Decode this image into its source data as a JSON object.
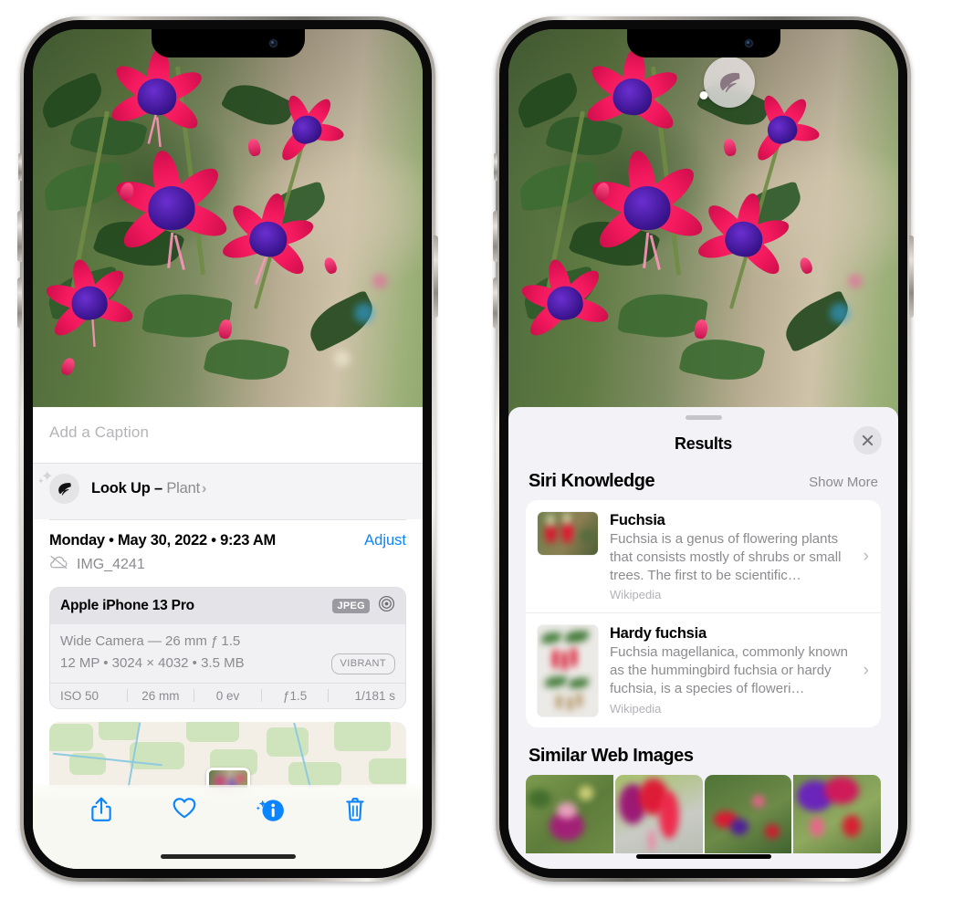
{
  "left_phone": {
    "caption": {
      "placeholder": "Add a Caption",
      "value": ""
    },
    "look_up": {
      "label": "Look Up",
      "dash": "–",
      "subject": "Plant",
      "chevron": "›",
      "icon": "leaf-icon"
    },
    "date_line": "Monday • May 30, 2022 • 9:23 AM",
    "adjust_label": "Adjust",
    "file_name": "IMG_4241",
    "cloud_icon": "cloud-slash-icon",
    "exif": {
      "model": "Apple iPhone 13 Pro",
      "format_badge": "JPEG",
      "aperture_icon": "aperture-icon",
      "lens_line": "Wide Camera — 26 mm ƒ 1.5",
      "spec_line": "12 MP • 3024 × 4032 • 3.5 MB",
      "style_badge": "VIBRANT",
      "stats": [
        "ISO 50",
        "26 mm",
        "0 ev",
        "ƒ1.5",
        "1/181 s"
      ]
    },
    "toolbar": [
      {
        "name": "share-button",
        "icon": "share-icon"
      },
      {
        "name": "favorite-button",
        "icon": "heart-icon"
      },
      {
        "name": "info-button",
        "icon": "info-sparkle-icon"
      },
      {
        "name": "delete-button",
        "icon": "trash-icon"
      }
    ],
    "map": {
      "pin_icon": "photo-pin"
    }
  },
  "right_phone": {
    "visual_lookup_badge": {
      "icon": "leaf-icon"
    },
    "sheet": {
      "title": "Results",
      "close_icon": "close-icon",
      "sections": [
        {
          "title": "Siri Knowledge",
          "action": "Show More",
          "items": [
            {
              "title": "Fuchsia",
              "description": "Fuchsia is a genus of flowering plants that consists mostly of shrubs or small trees. The first to be scientific…",
              "source": "Wikipedia",
              "chevron": "›"
            },
            {
              "title": "Hardy fuchsia",
              "description": "Fuchsia magellanica, commonly known as the hummingbird fuchsia or hardy fuchsia, is a species of floweri…",
              "source": "Wikipedia",
              "chevron": "›"
            }
          ]
        },
        {
          "title": "Similar Web Images",
          "images": [
            "web-image-1",
            "web-image-2",
            "web-image-3",
            "web-image-4"
          ]
        }
      ]
    }
  },
  "colors": {
    "accent_blue": "#0a84ff",
    "sheet_bg": "#f2f2f7",
    "card_bg": "#ffffff",
    "secondary_text": "#8b8b90",
    "exif_bg": "#e9e9ed"
  }
}
